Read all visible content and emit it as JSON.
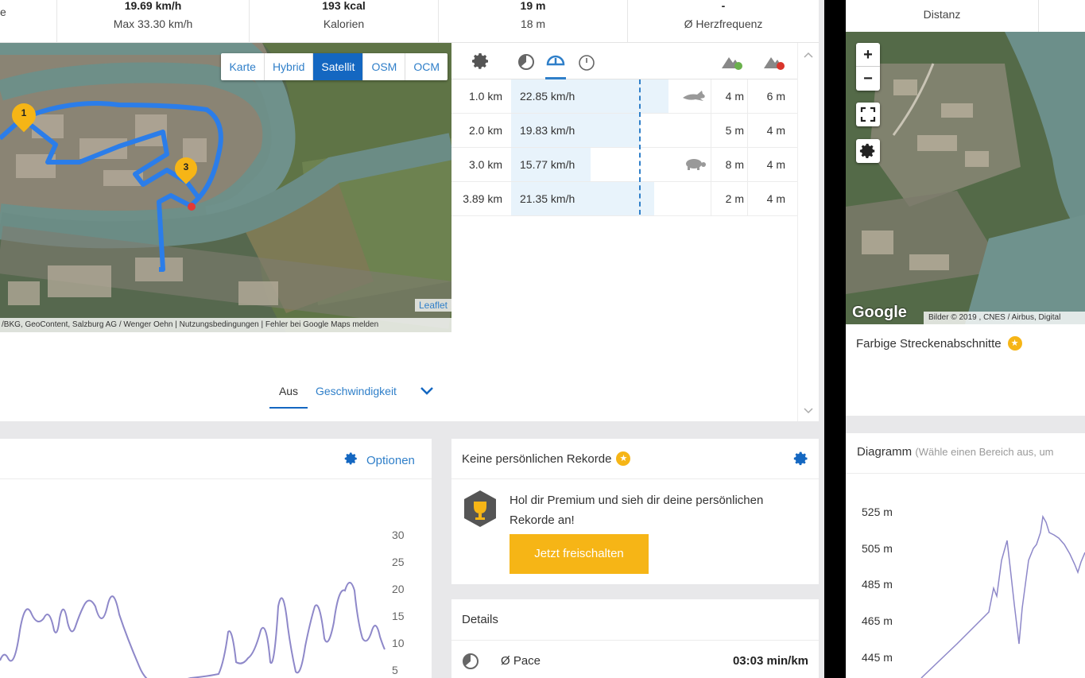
{
  "stats": [
    {
      "value": "19.69 km/h",
      "label": "Max 33.30 km/h"
    },
    {
      "value": "193 kcal",
      "label": "Kalorien"
    },
    {
      "value": "19 m",
      "label": "18 m"
    },
    {
      "value": "-",
      "label": "Ø Herzfrequenz"
    }
  ],
  "stats_left_partial": "e",
  "map": {
    "types": [
      "Karte",
      "Hybrid",
      "Satellit",
      "OSM",
      "OCM"
    ],
    "active_type": "Satellit",
    "markers": [
      "1",
      "3"
    ],
    "leaflet": "Leaflet",
    "attribution": "/BKG, GeoContent, Salzburg AG / Wenger Oehn  |  Nutzungsbedingungen  |  Fehler bei Google Maps melden"
  },
  "coloring": {
    "off_label": "Aus",
    "speed_label": "Geschwindigkeit"
  },
  "laps": [
    {
      "dist": "1.0 km",
      "speed": "22.85 km/h",
      "speed_frac": 0.87,
      "icon": "rabbit-icon",
      "up": "4 m",
      "down": "6 m"
    },
    {
      "dist": "2.0 km",
      "speed": "19.83 km/h",
      "speed_frac": 0.75,
      "icon": "",
      "up": "5 m",
      "down": "4 m"
    },
    {
      "dist": "3.0 km",
      "speed": "15.77 km/h",
      "speed_frac": 0.6,
      "icon": "turtle-icon",
      "up": "8 m",
      "down": "4 m"
    },
    {
      "dist": "3.89 km",
      "speed": "21.35 km/h",
      "speed_frac": 0.81,
      "icon": "",
      "up": "2 m",
      "down": "4 m"
    }
  ],
  "chart_card": {
    "options_label": "Optionen",
    "y_ticks": [
      "30",
      "25",
      "20",
      "15",
      "10",
      "5"
    ]
  },
  "records": {
    "title": "Keine persönlichen Rekorde",
    "message": "Hol dir Premium und sieh dir deine persönlichen Rekorde an!",
    "button": "Jetzt freischalten"
  },
  "details": {
    "title": "Details",
    "pace_label": "Ø Pace",
    "pace_value": "03:03 min/km"
  },
  "right": {
    "stat_label": "Distanz",
    "zoom_in": "+",
    "zoom_out": "−",
    "google": "Google",
    "attribution": "Bilder © 2019 , CNES / Airbus, Digital",
    "segments_title": "Farbige Streckenabschnitte",
    "diagram_title": "Diagramm",
    "diagram_hint": "(Wähle einen Bereich aus, um",
    "y_ticks": [
      "525 m",
      "505 m",
      "485 m",
      "465 m",
      "445 m"
    ]
  },
  "colors": {
    "accent": "#1467c1",
    "link": "#2f7fc9",
    "premium": "#f6b516",
    "route": "#2b7de9",
    "chart_line": "#8e88c9"
  }
}
